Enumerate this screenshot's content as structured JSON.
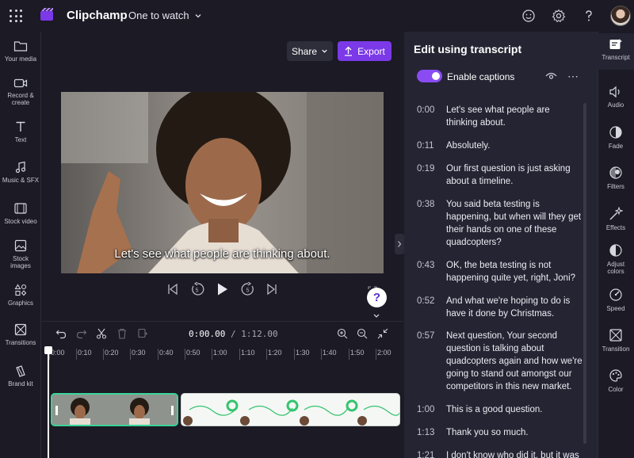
{
  "app": {
    "title": "Clipchamp",
    "project_name": "One to watch",
    "accent": "#7b39e8",
    "user": "user avatar"
  },
  "left_rail": [
    {
      "label": "Your media",
      "icon": "folder-icon"
    },
    {
      "label": "Record &\ncreate",
      "icon": "camera-icon"
    },
    {
      "label": "Text",
      "icon": "text-icon"
    },
    {
      "label": "Music & SFX",
      "icon": "music-icon"
    },
    {
      "label": "Stock video",
      "icon": "film-icon"
    },
    {
      "label": "Stock\nimages",
      "icon": "image-icon"
    },
    {
      "label": "Graphics",
      "icon": "shapes-icon"
    },
    {
      "label": "Transitions",
      "icon": "transitions-icon"
    },
    {
      "label": "Brand kit",
      "icon": "brand-icon"
    }
  ],
  "preview": {
    "share_label": "Share",
    "export_label": "Export",
    "caption": "Let's see what people are thinking about.",
    "help_label": "?"
  },
  "timeline": {
    "current_time": "0:00.00",
    "separator": "/",
    "total_time": "1:12.00",
    "ticks": [
      "0:00",
      "0:10",
      "0:20",
      "0:30",
      "0:40",
      "0:50",
      "1:00",
      "1:10",
      "1:20",
      "1:30",
      "1:40",
      "1:50",
      "2:00"
    ]
  },
  "transcript": {
    "title": "Edit using transcript",
    "toggle_label": "Enable captions",
    "toggle_on": true,
    "lines": [
      {
        "time": "0:00",
        "text": "Let's see what people are thinking about."
      },
      {
        "time": "0:11",
        "text": "Absolutely."
      },
      {
        "time": "0:19",
        "text": "Our first question is just asking about a timeline."
      },
      {
        "time": "0:38",
        "text": "You said beta testing is happening, but when will they get their hands on one of these quadcopters?"
      },
      {
        "time": "0:43",
        "text": "OK, the beta testing is not happening quite yet, right, Joni?"
      },
      {
        "time": "0:52",
        "text": "And what we're hoping to do is have it done by Christmas."
      },
      {
        "time": "0:57",
        "text": "Next question, Your second question is talking about quadcopters again and how we're going to stand out amongst our competitors in this new market."
      },
      {
        "time": "1:00",
        "text": "This is a good question."
      },
      {
        "time": "1:13",
        "text": "Thank you so much."
      },
      {
        "time": "1:21",
        "text": "I don't know who did it, but it was"
      }
    ]
  },
  "right_rail": [
    {
      "label": "Transcript",
      "icon": "transcript-icon",
      "active": true
    },
    {
      "label": "Audio",
      "icon": "speaker-icon"
    },
    {
      "label": "Fade",
      "icon": "fade-icon"
    },
    {
      "label": "Filters",
      "icon": "filters-icon"
    },
    {
      "label": "Effects",
      "icon": "effects-icon"
    },
    {
      "label": "Adjust\ncolors",
      "icon": "adjust-icon"
    },
    {
      "label": "Speed",
      "icon": "speed-icon"
    },
    {
      "label": "Transition",
      "icon": "transition-icon"
    },
    {
      "label": "Color",
      "icon": "palette-icon"
    }
  ]
}
